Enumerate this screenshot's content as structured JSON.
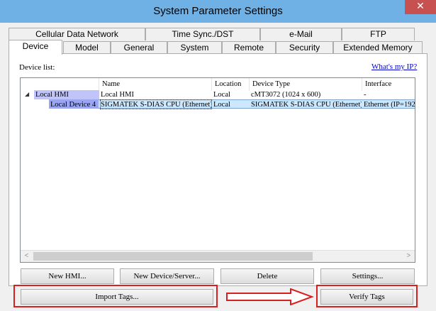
{
  "window": {
    "title": "System Parameter Settings",
    "close_glyph": "✕"
  },
  "tabs_back": [
    {
      "label": "Cellular Data Network"
    },
    {
      "label": "Time Sync./DST"
    },
    {
      "label": "e-Mail"
    },
    {
      "label": "FTP"
    }
  ],
  "tabs_front": [
    {
      "label": "Device",
      "active": true
    },
    {
      "label": "Model"
    },
    {
      "label": "General"
    },
    {
      "label": "System"
    },
    {
      "label": "Remote"
    },
    {
      "label": "Security"
    },
    {
      "label": "Extended Memory"
    }
  ],
  "device_panel": {
    "list_label": "Device list:",
    "whats_my_ip": "What's my IP?",
    "columns": [
      "Name",
      "Location",
      "Device Type",
      "Interface"
    ],
    "rows": [
      {
        "tree": "Local HMI",
        "name": "Local HMI",
        "location": "Local",
        "device_type": "cMT3072 (1024 x 600)",
        "interface": "-"
      },
      {
        "tree": "Local Device 4",
        "name": "SIGMATEK S-DIAS CPU (Ethernet)",
        "location": "Local",
        "device_type": "SIGMATEK S-DIAS CPU (Ethernet)",
        "interface": "Ethernet (IP=192"
      }
    ],
    "expander_glyph": "◢",
    "scroll_left": "<",
    "scroll_right": ">"
  },
  "buttons": {
    "new_hmi": "New HMI...",
    "new_device": "New Device/Server...",
    "delete": "Delete",
    "settings": "Settings...",
    "import_tags": "Import Tags...",
    "verify_tags": "Verify Tags"
  },
  "annotation_color": "#d92020"
}
